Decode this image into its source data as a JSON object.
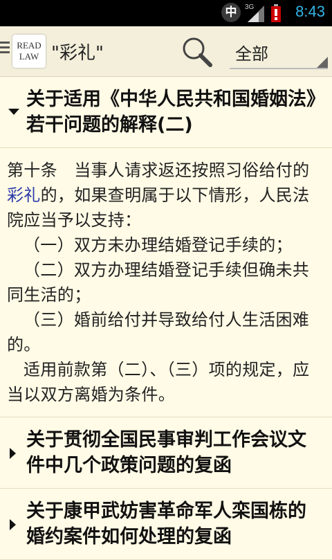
{
  "status_bar": {
    "ime": "中",
    "network": "3G",
    "time": "8:43"
  },
  "action_bar": {
    "logo_line1": "READ",
    "logo_line2": "LAW",
    "title": "\"彩礼\"",
    "filter": "全部"
  },
  "results": [
    {
      "title": "关于适用《中华人民共和国婚姻法》若干问题的解释(二)",
      "expanded": true,
      "body": {
        "p1_before": "第十条　当事人请求返还按照习俗给付的",
        "p1_highlight": "彩礼",
        "p1_after": "的，如果查明属于以下情形，人民法院应当予以支持：",
        "p2": "（一）双方未办理结婚登记手续的；",
        "p3": "（二）双方办理结婚登记手续但确未共同生活的；",
        "p4": "（三）婚前给付并导致给付人生活困难的。",
        "p5": "适用前款第（二）、（三）项的规定，应当以双方离婚为条件。"
      }
    },
    {
      "title": "关于贯彻全国民事审判工作会议文件中几个政策问题的复函",
      "expanded": false
    },
    {
      "title": "关于康甲武妨害革命军人栾国栋的婚约案件如何处理的复函",
      "expanded": false
    }
  ],
  "colors": {
    "background": "#fffbe6",
    "status_accent": "#33b5e5",
    "highlight": "#2b3aa8"
  }
}
